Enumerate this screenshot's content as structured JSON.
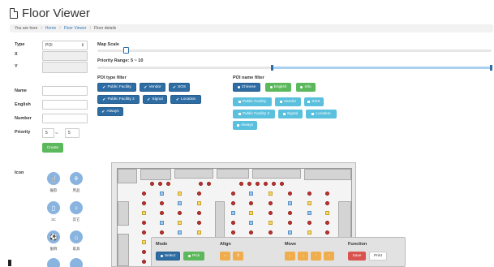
{
  "header": {
    "title": "Floor Viewer"
  },
  "breadcrumb": {
    "prefix": "You are here",
    "home": "Home",
    "floor_viewer": "Floor Viewer",
    "current": "Floor details"
  },
  "form": {
    "type_label": "Type",
    "type_value": "POI",
    "type_arrow": "⇕",
    "x_label": "X",
    "y_label": "Y",
    "name_label": "Name",
    "english_label": "English",
    "number_label": "Number",
    "priority_label": "Priority",
    "priority_min": "5",
    "priority_dash": "~",
    "priority_max": "5",
    "create_label": "Create"
  },
  "map_scale": {
    "label": "Map Scale"
  },
  "priority_range": {
    "label": "Priority Range: 5 ~ 10"
  },
  "poi_type_filter": {
    "label": "POI type filter",
    "items": [
      "Public Facility",
      "Vendor",
      "SOS",
      "Public Facility 2",
      "Signal",
      "Location",
      "Always"
    ]
  },
  "poi_name_filter": {
    "label": "POI name filter",
    "languages": [
      "Chinese",
      "English",
      "Info"
    ],
    "items": [
      "Public Facility",
      "Vendor",
      "SOS",
      "Public Facility 2",
      "Signal",
      "Location",
      "Always"
    ]
  },
  "icon_panel": {
    "label": "Icon",
    "icons": [
      {
        "name": "dining-icon",
        "caption": "餐飲"
      },
      {
        "name": "goods-icon",
        "caption": "用品"
      },
      {
        "name": "3c-icon",
        "caption": "3C"
      },
      {
        "name": "other-icon",
        "caption": "其它"
      },
      {
        "name": "clothing-icon",
        "caption": "服飾"
      },
      {
        "name": "home-icon",
        "caption": "家具"
      }
    ]
  },
  "toolbar": {
    "mode_label": "Mode",
    "select_label": "Select",
    "pick_label": "Pick",
    "align_label": "Align",
    "align_h": "⇔",
    "align_v": "⇕",
    "move_label": "Move",
    "move_left": "←",
    "move_right": "→",
    "move_up": "↑",
    "move_down": "↓",
    "function_label": "Function",
    "save_label": "Save",
    "print_label": "Print"
  },
  "colors": {
    "primary": "#2e6da4",
    "info": "#5bc0de",
    "success": "#5cb85c",
    "warning": "#f0ad4e",
    "danger": "#d9534f"
  }
}
